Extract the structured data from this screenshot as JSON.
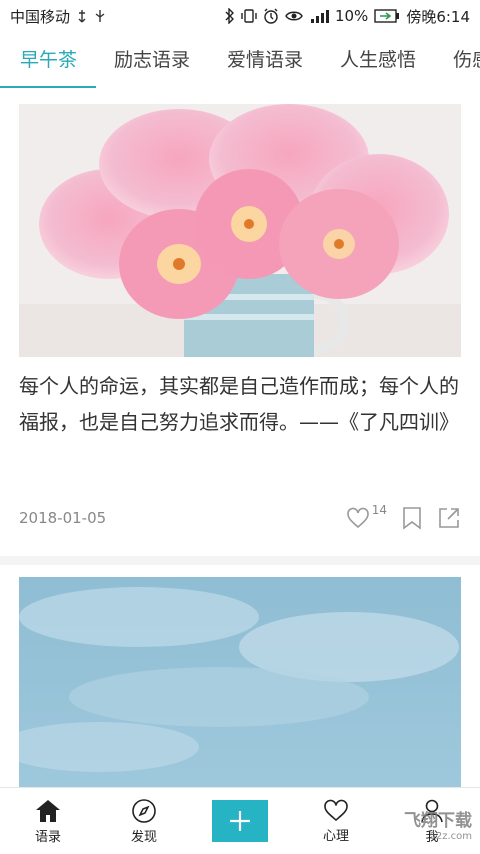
{
  "status_bar": {
    "carrier": "中国移动",
    "battery": "10%",
    "time": "傍晚6:14"
  },
  "tabs": [
    {
      "label": "早午茶",
      "active": true
    },
    {
      "label": "励志语录",
      "active": false
    },
    {
      "label": "爱情语录",
      "active": false
    },
    {
      "label": "人生感悟",
      "active": false
    },
    {
      "label": "伤感",
      "active": false
    }
  ],
  "feed": [
    {
      "image": "pink-tulips-in-pitcher",
      "quote": "每个人的命运，其实都是自己造作而成；每个人的福报，也是自己努力追求而得。——《了凡四训》",
      "date": "2018-01-05",
      "likes": "14"
    },
    {
      "image": "blue-sky-with-clouds"
    }
  ],
  "bottom_nav": {
    "items": [
      {
        "label": "语录",
        "icon": "home-icon"
      },
      {
        "label": "发现",
        "icon": "compass-icon"
      },
      {
        "label": "",
        "icon": "plus-icon"
      },
      {
        "label": "心理",
        "icon": "heart-icon"
      },
      {
        "label": "我",
        "icon": "user-icon"
      }
    ]
  },
  "watermark": {
    "text": "飞翔下载",
    "sub": "52z.com"
  },
  "colors": {
    "accent": "#2aa9b8",
    "add_button": "#26b3c3"
  }
}
